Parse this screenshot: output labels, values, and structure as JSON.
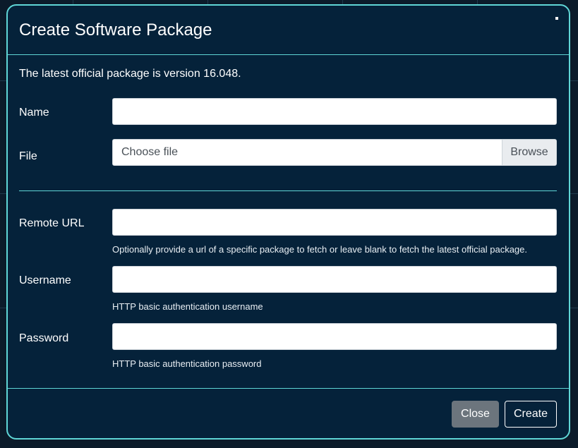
{
  "modal": {
    "title": "Create Software Package"
  },
  "intro_text": "The latest official package is version 16.048.",
  "fields": {
    "name": {
      "label": "Name",
      "value": "",
      "placeholder": ""
    },
    "file": {
      "label": "File",
      "placeholder": "Choose file",
      "browse_label": "Browse"
    },
    "remote_url": {
      "label": "Remote URL",
      "value": "",
      "help": "Optionally provide a url of a specific package to fetch or leave blank to fetch the latest official package."
    },
    "username": {
      "label": "Username",
      "value": "",
      "help": "HTTP basic authentication username"
    },
    "password": {
      "label": "Password",
      "value": "",
      "help": "HTTP basic authentication password"
    }
  },
  "footer": {
    "close_label": "Close",
    "create_label": "Create"
  },
  "colors": {
    "modal_bg": "#05223a",
    "accent_border": "#5fd6d6",
    "close_button": "#6c757d"
  }
}
